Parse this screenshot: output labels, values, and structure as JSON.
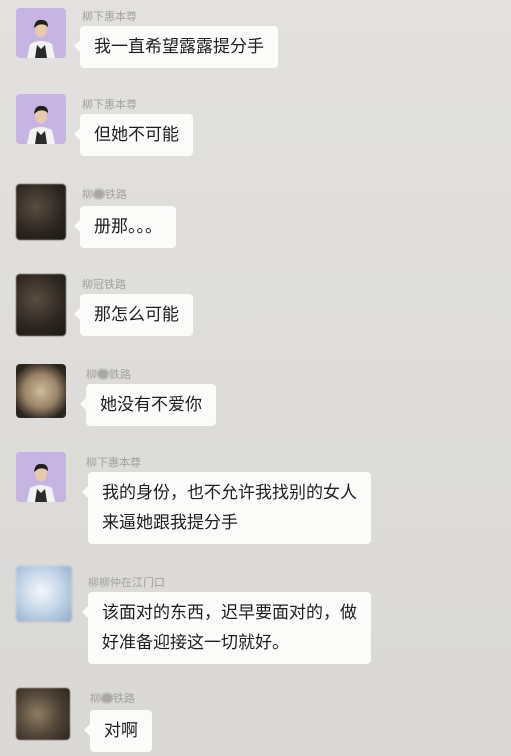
{
  "messages": [
    {
      "sender": "柳下惠本尊",
      "sender_prefix": "",
      "sender_suffix": "",
      "text": "我一直希望露露提分手",
      "avatar_icon": "man-avatar-icon"
    },
    {
      "sender": "柳下惠本尊",
      "sender_prefix": "",
      "sender_suffix": "",
      "text": "但她不可能",
      "avatar_icon": "man-avatar-icon"
    },
    {
      "sender": "柳■铁路",
      "sender_prefix": "柳",
      "sender_suffix": "铁路",
      "text": "册那。。。",
      "avatar_icon": "blurred-avatar-icon"
    },
    {
      "sender": "柳冠铁路",
      "sender_prefix": "",
      "sender_suffix": "",
      "text": "那怎么可能",
      "avatar_icon": "blurred-avatar-icon"
    },
    {
      "sender": "柳■鉄路",
      "sender_prefix": "柳",
      "sender_suffix": "鉄路",
      "text": "她没有不爱你",
      "avatar_icon": "furry-avatar-icon"
    },
    {
      "sender": "柳下惠本尊",
      "sender_prefix": "",
      "sender_suffix": "",
      "text": "我的身份，也不允许我找别的女人\n来逼她跟我提分手",
      "avatar_icon": "man-avatar-icon"
    },
    {
      "sender": "柳柳仲在江门口",
      "sender_prefix": "",
      "sender_suffix": "",
      "text": "该面对的东西，迟早要面对的，做\n好准备迎接这一切就好。",
      "avatar_icon": "blurred-avatar-icon"
    },
    {
      "sender": "柳■铁路",
      "sender_prefix": "柳",
      "sender_suffix": "铁路",
      "text": "对啊",
      "avatar_icon": "blurred-avatar-icon"
    }
  ]
}
